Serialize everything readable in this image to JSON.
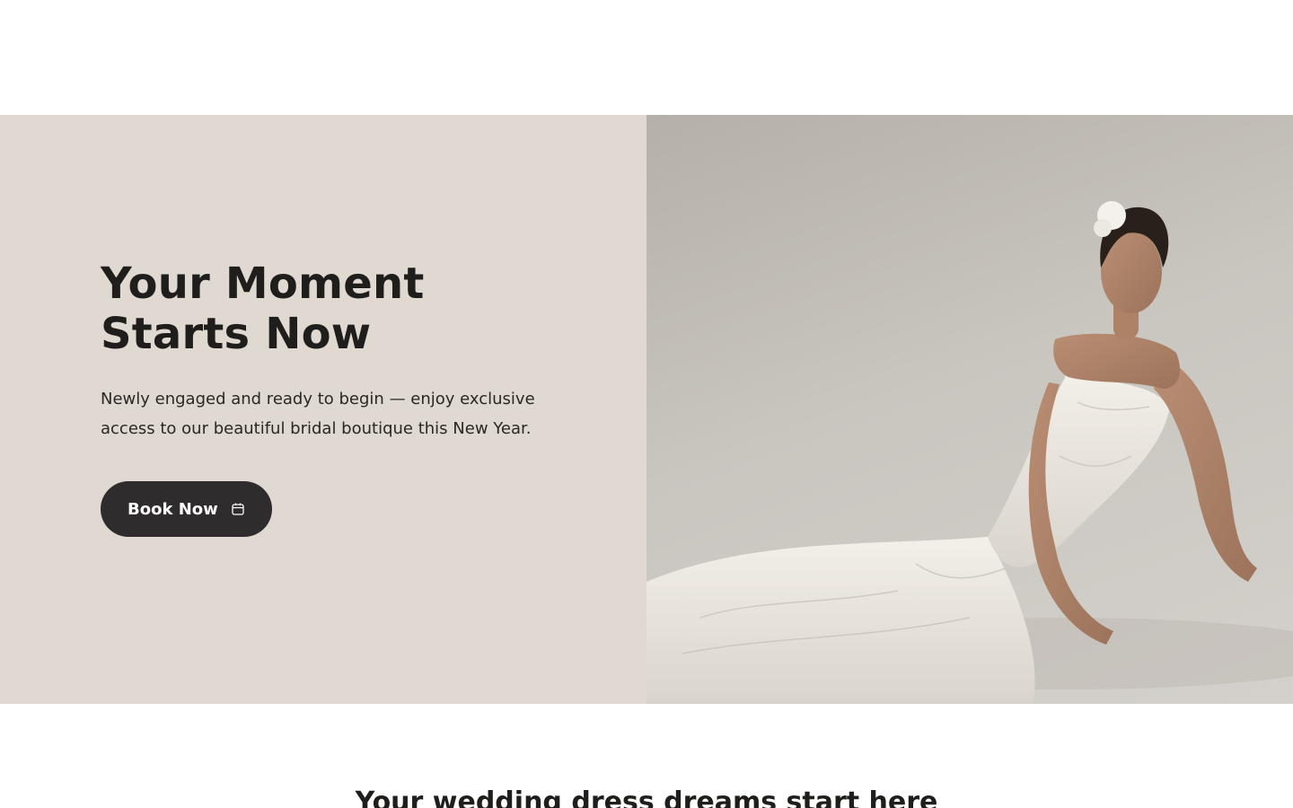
{
  "hero": {
    "title_line1": "Your Moment",
    "title_line2": "Starts Now",
    "subtitle_line1": "Newly engaged and ready to begin — enjoy exclusive",
    "subtitle_line2": "access to our beautiful bridal boutique this New Year.",
    "button_label": "Book Now",
    "button_icon": "calendar-icon",
    "image_alt": "bride-photo"
  },
  "section": {
    "title": "Your wedding dress dreams start here"
  },
  "colors": {
    "hero_left_bg": "#e0d9d1",
    "button_bg": "#2e2c2c",
    "button_text": "#ffffff",
    "heading_text": "#201e1c"
  }
}
